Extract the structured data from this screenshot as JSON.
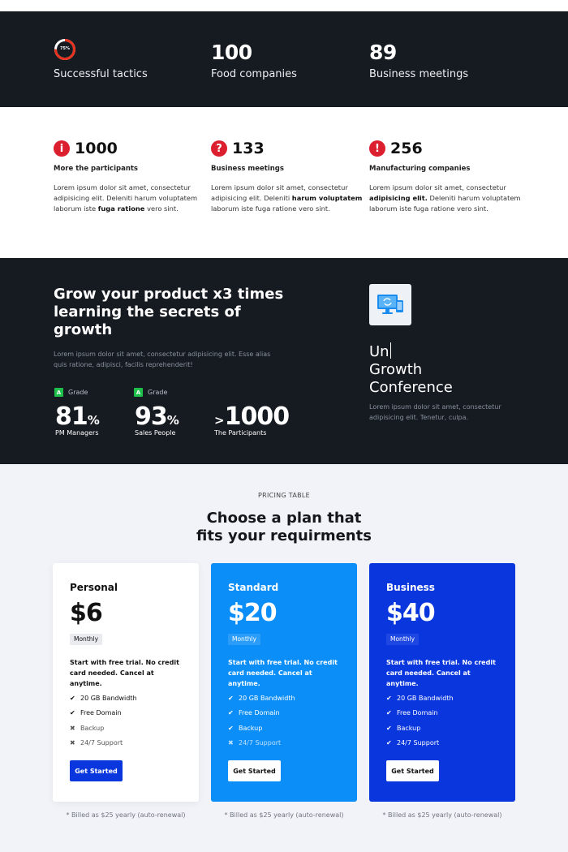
{
  "stats": [
    {
      "value": "75%",
      "label": "Successful tactics",
      "progress": 75
    },
    {
      "value": "100",
      "label": "Food companies"
    },
    {
      "value": "89",
      "label": "Business meetings"
    }
  ],
  "features": [
    {
      "icon": "info-icon",
      "icon_glyph": "i",
      "number": "1000",
      "title": "More the participants",
      "text_before": "Lorem ipsum dolor sit amet, consectetur adipisicing elit. Deleniti harum voluptatem laborum iste ",
      "text_bold": "fuga ratione",
      "text_after": " vero sint."
    },
    {
      "icon": "question-icon",
      "icon_glyph": "?",
      "number": "133",
      "title": "Business meetings",
      "text_before": "Lorem ipsum dolor sit amet, consectetur adipisicing elit. Deleniti ",
      "text_bold": "harum voluptatem",
      "text_after": " laborum iste fuga ratione vero sint."
    },
    {
      "icon": "alert-icon",
      "icon_glyph": "!",
      "number": "256",
      "title": "Manufacturing companies",
      "text_before": "Lorem ipsum dolor sit amet, consectetur ",
      "text_bold": "adipisicing elit.",
      "text_after": " Deleniti harum voluptatem laborum iste fuga ratione vero sint."
    }
  ],
  "growth": {
    "title": "Grow your product x3 times learning the secrets of growth",
    "lead": "Lorem ipsum dolor sit amet, consectetur adipisicing elit. Esse alias quis ratione, adipisci, facilis reprehenderit!",
    "grade_badge": "A",
    "grade_label": "Grade",
    "metrics": [
      {
        "value": "81",
        "suffix": "%",
        "caption": "PM Managers"
      },
      {
        "value": "93",
        "suffix": "%",
        "caption": "Sales People"
      },
      {
        "prefix": ">",
        "value": "1000",
        "caption": "The Participants"
      }
    ],
    "conference": {
      "line1": "Un",
      "line2": "Growth",
      "line3": "Conference",
      "text": "Lorem ipsum dolor sit amet, consectetur adipisicing elit. Tenetur, culpa."
    },
    "app_icon": "sync-devices-icon"
  },
  "pricing": {
    "eyebrow": "PRICING TABLE",
    "title_line1": "Choose a plan that",
    "title_line2": "fits your requirments",
    "plans": [
      {
        "name": "Personal",
        "price": "$6",
        "period": "Monthly",
        "description": "Start with free trial. No credit card needed. Cancel at anytime.",
        "features": [
          {
            "label": "20 GB Bandwidth",
            "included": true
          },
          {
            "label": "Free Domain",
            "included": true
          },
          {
            "label": "Backup",
            "included": false
          },
          {
            "label": "24/7 Support",
            "included": false
          }
        ],
        "button": "Get Started",
        "billed": "* Billed as $25 yearly (auto-renewal)"
      },
      {
        "name": "Standard",
        "price": "$20",
        "period": "Monthly",
        "description": "Start with free trial. No credit card needed. Cancel at anytime.",
        "features": [
          {
            "label": "20 GB Bandwidth",
            "included": true
          },
          {
            "label": "Free Domain",
            "included": true
          },
          {
            "label": "Backup",
            "included": true
          },
          {
            "label": "24/7 Support",
            "included": false
          }
        ],
        "button": "Get Started",
        "billed": "* Billed as $25 yearly (auto-renewal)"
      },
      {
        "name": "Business",
        "price": "$40",
        "period": "Monthly",
        "description": "Start with free trial. No credit card needed. Cancel at anytime.",
        "features": [
          {
            "label": "20 GB Bandwidth",
            "included": true
          },
          {
            "label": "Free Domain",
            "included": true
          },
          {
            "label": "Backup",
            "included": true
          },
          {
            "label": "24/7 Support",
            "included": true
          }
        ],
        "button": "Get Started",
        "billed": "* Billed as $25 yearly (auto-renewal)"
      }
    ]
  },
  "colors": {
    "dark_bg": "#161b22",
    "accent_red": "#dc1f2e",
    "standard_blue": "#0b8ef7",
    "business_blue": "#0a36dd",
    "grade_green": "#1fbf4c",
    "pricing_bg": "#f1f3f8"
  }
}
